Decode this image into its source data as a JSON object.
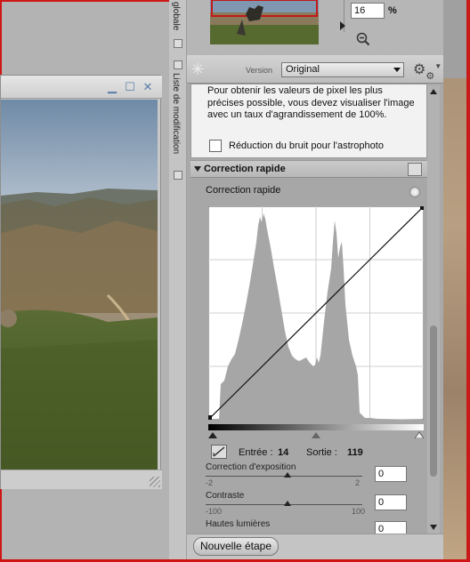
{
  "app": {
    "colors": {
      "border_red": "#d01515",
      "panel_gray": "#a9a9a9"
    }
  },
  "document_window": {
    "buttons": {
      "minimize": "minimize-icon",
      "maximize": "maximize-icon",
      "close": "close-icon"
    }
  },
  "side_tabs": {
    "top_tab": "globale",
    "edit_tab": "Liste de modification"
  },
  "navigator": {
    "zoom_value": "16",
    "zoom_unit": "%"
  },
  "edit_list": {
    "version_label": "Version",
    "version_value": "Original",
    "info_text": "Pour obtenir les valeurs de pixel les plus précises possible, vous devez visualiser l'image avec un taux d'agrandissement de 100%.",
    "noise_checkbox_label": "Réduction du bruit pour l'astrophoto",
    "section_title": "Correction rapide",
    "qf_label": "Correction rapide",
    "input_label": "Entrée :",
    "input_value": "14",
    "output_label": "Sortie :",
    "output_value": "119",
    "adjustments": [
      {
        "label": "Correction d'exposition",
        "min": "-2",
        "max": "2",
        "value": "0"
      },
      {
        "label": "Contraste",
        "min": "-100",
        "max": "100",
        "value": "0"
      },
      {
        "label": "Hautes lumières",
        "min": "",
        "max": "",
        "value": "0"
      }
    ]
  },
  "bottom": {
    "new_step_label": "Nouvelle étape"
  }
}
